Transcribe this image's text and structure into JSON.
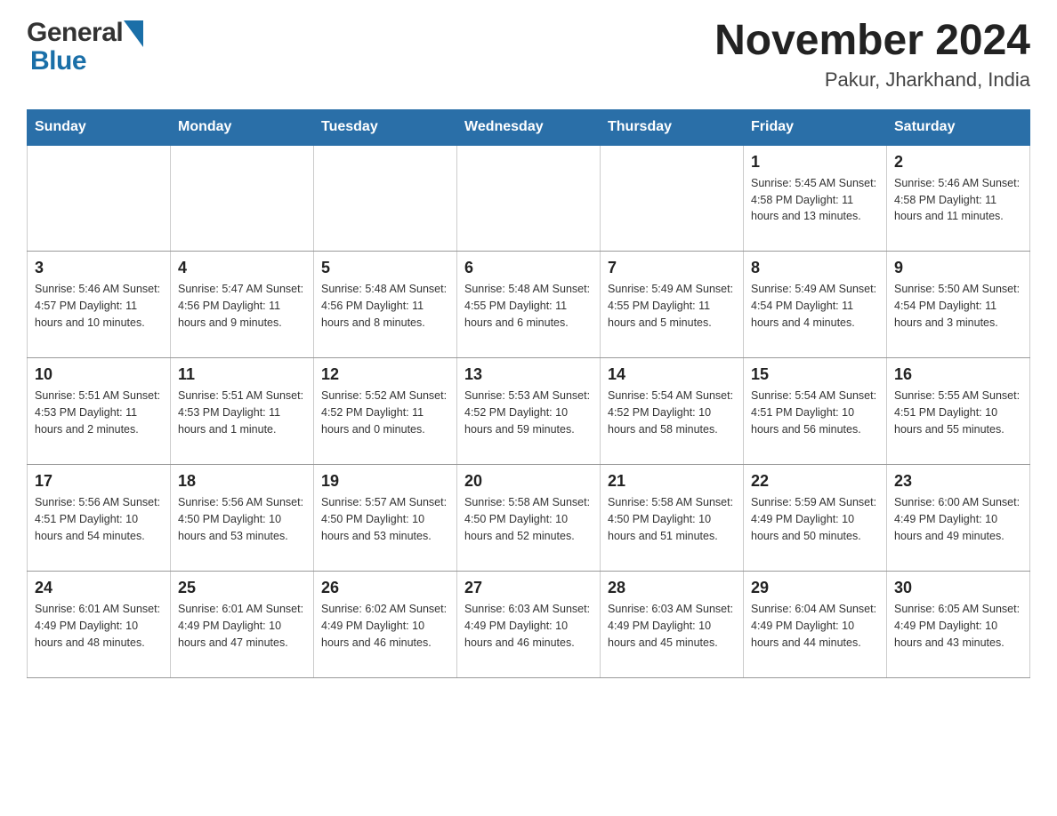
{
  "header": {
    "logo_general": "General",
    "logo_blue": "Blue",
    "month_title": "November 2024",
    "location": "Pakur, Jharkhand, India"
  },
  "calendar": {
    "days_of_week": [
      "Sunday",
      "Monday",
      "Tuesday",
      "Wednesday",
      "Thursday",
      "Friday",
      "Saturday"
    ],
    "weeks": [
      [
        {
          "day": "",
          "info": ""
        },
        {
          "day": "",
          "info": ""
        },
        {
          "day": "",
          "info": ""
        },
        {
          "day": "",
          "info": ""
        },
        {
          "day": "",
          "info": ""
        },
        {
          "day": "1",
          "info": "Sunrise: 5:45 AM\nSunset: 4:58 PM\nDaylight: 11 hours and 13 minutes."
        },
        {
          "day": "2",
          "info": "Sunrise: 5:46 AM\nSunset: 4:58 PM\nDaylight: 11 hours and 11 minutes."
        }
      ],
      [
        {
          "day": "3",
          "info": "Sunrise: 5:46 AM\nSunset: 4:57 PM\nDaylight: 11 hours and 10 minutes."
        },
        {
          "day": "4",
          "info": "Sunrise: 5:47 AM\nSunset: 4:56 PM\nDaylight: 11 hours and 9 minutes."
        },
        {
          "day": "5",
          "info": "Sunrise: 5:48 AM\nSunset: 4:56 PM\nDaylight: 11 hours and 8 minutes."
        },
        {
          "day": "6",
          "info": "Sunrise: 5:48 AM\nSunset: 4:55 PM\nDaylight: 11 hours and 6 minutes."
        },
        {
          "day": "7",
          "info": "Sunrise: 5:49 AM\nSunset: 4:55 PM\nDaylight: 11 hours and 5 minutes."
        },
        {
          "day": "8",
          "info": "Sunrise: 5:49 AM\nSunset: 4:54 PM\nDaylight: 11 hours and 4 minutes."
        },
        {
          "day": "9",
          "info": "Sunrise: 5:50 AM\nSunset: 4:54 PM\nDaylight: 11 hours and 3 minutes."
        }
      ],
      [
        {
          "day": "10",
          "info": "Sunrise: 5:51 AM\nSunset: 4:53 PM\nDaylight: 11 hours and 2 minutes."
        },
        {
          "day": "11",
          "info": "Sunrise: 5:51 AM\nSunset: 4:53 PM\nDaylight: 11 hours and 1 minute."
        },
        {
          "day": "12",
          "info": "Sunrise: 5:52 AM\nSunset: 4:52 PM\nDaylight: 11 hours and 0 minutes."
        },
        {
          "day": "13",
          "info": "Sunrise: 5:53 AM\nSunset: 4:52 PM\nDaylight: 10 hours and 59 minutes."
        },
        {
          "day": "14",
          "info": "Sunrise: 5:54 AM\nSunset: 4:52 PM\nDaylight: 10 hours and 58 minutes."
        },
        {
          "day": "15",
          "info": "Sunrise: 5:54 AM\nSunset: 4:51 PM\nDaylight: 10 hours and 56 minutes."
        },
        {
          "day": "16",
          "info": "Sunrise: 5:55 AM\nSunset: 4:51 PM\nDaylight: 10 hours and 55 minutes."
        }
      ],
      [
        {
          "day": "17",
          "info": "Sunrise: 5:56 AM\nSunset: 4:51 PM\nDaylight: 10 hours and 54 minutes."
        },
        {
          "day": "18",
          "info": "Sunrise: 5:56 AM\nSunset: 4:50 PM\nDaylight: 10 hours and 53 minutes."
        },
        {
          "day": "19",
          "info": "Sunrise: 5:57 AM\nSunset: 4:50 PM\nDaylight: 10 hours and 53 minutes."
        },
        {
          "day": "20",
          "info": "Sunrise: 5:58 AM\nSunset: 4:50 PM\nDaylight: 10 hours and 52 minutes."
        },
        {
          "day": "21",
          "info": "Sunrise: 5:58 AM\nSunset: 4:50 PM\nDaylight: 10 hours and 51 minutes."
        },
        {
          "day": "22",
          "info": "Sunrise: 5:59 AM\nSunset: 4:49 PM\nDaylight: 10 hours and 50 minutes."
        },
        {
          "day": "23",
          "info": "Sunrise: 6:00 AM\nSunset: 4:49 PM\nDaylight: 10 hours and 49 minutes."
        }
      ],
      [
        {
          "day": "24",
          "info": "Sunrise: 6:01 AM\nSunset: 4:49 PM\nDaylight: 10 hours and 48 minutes."
        },
        {
          "day": "25",
          "info": "Sunrise: 6:01 AM\nSunset: 4:49 PM\nDaylight: 10 hours and 47 minutes."
        },
        {
          "day": "26",
          "info": "Sunrise: 6:02 AM\nSunset: 4:49 PM\nDaylight: 10 hours and 46 minutes."
        },
        {
          "day": "27",
          "info": "Sunrise: 6:03 AM\nSunset: 4:49 PM\nDaylight: 10 hours and 46 minutes."
        },
        {
          "day": "28",
          "info": "Sunrise: 6:03 AM\nSunset: 4:49 PM\nDaylight: 10 hours and 45 minutes."
        },
        {
          "day": "29",
          "info": "Sunrise: 6:04 AM\nSunset: 4:49 PM\nDaylight: 10 hours and 44 minutes."
        },
        {
          "day": "30",
          "info": "Sunrise: 6:05 AM\nSunset: 4:49 PM\nDaylight: 10 hours and 43 minutes."
        }
      ]
    ]
  }
}
